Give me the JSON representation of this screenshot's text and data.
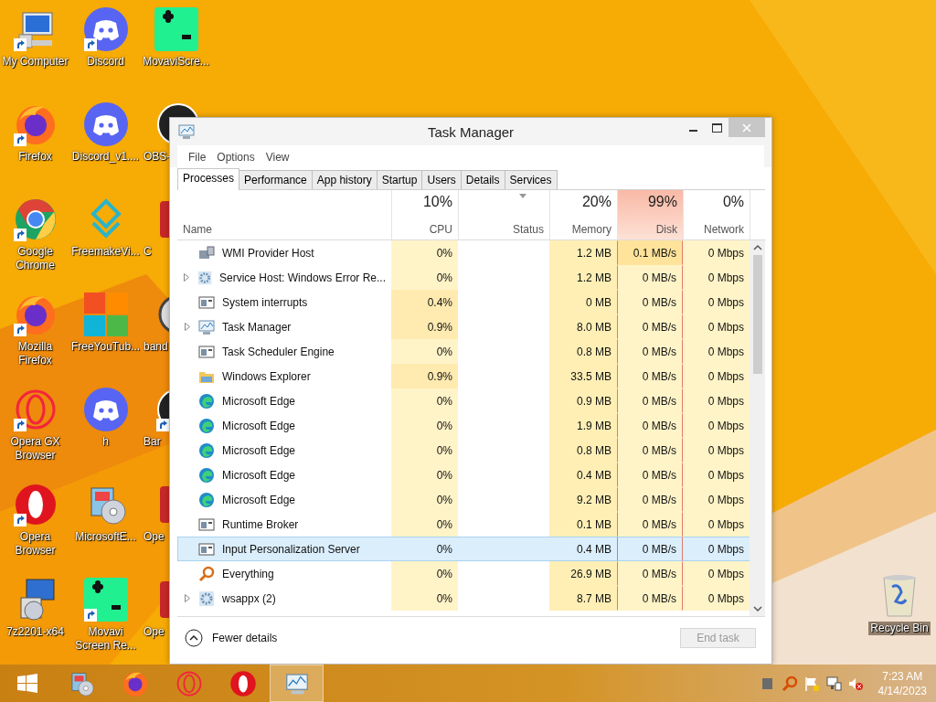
{
  "desktop_icons": [
    {
      "label": "My Computer",
      "kind": "computer",
      "shortcut": true
    },
    {
      "label": "Discord",
      "kind": "discord",
      "shortcut": true
    },
    {
      "label": "MovaviScre...",
      "kind": "movavi",
      "shortcut": false
    },
    {
      "label": "Firefox",
      "kind": "firefox",
      "shortcut": true
    },
    {
      "label": "Discord_v1....",
      "kind": "discord",
      "shortcut": false
    },
    {
      "label": "OBS-",
      "kind": "obs",
      "shortcut": false
    },
    {
      "label": "Google Chrome",
      "kind": "chrome",
      "shortcut": true
    },
    {
      "label": "FreemakeVi...",
      "kind": "freemake",
      "shortcut": false
    },
    {
      "label": "C",
      "kind": "redapp",
      "shortcut": false
    },
    {
      "label": "Mozilla Firefox",
      "kind": "firefox",
      "shortcut": true
    },
    {
      "label": "FreeYouTub...",
      "kind": "tiles",
      "shortcut": false
    },
    {
      "label": "band",
      "kind": "disc",
      "shortcut": false
    },
    {
      "label": "Opera GX Browser",
      "kind": "operagx",
      "shortcut": true
    },
    {
      "label": "h",
      "kind": "discord",
      "shortcut": false
    },
    {
      "label": "Bar",
      "kind": "obs",
      "shortcut": true
    },
    {
      "label": "Opera Browser",
      "kind": "opera",
      "shortcut": true
    },
    {
      "label": "MicrosoftE...",
      "kind": "installer",
      "shortcut": false
    },
    {
      "label": "Ope",
      "kind": "redapp",
      "shortcut": false
    },
    {
      "label": "7z2201-x64",
      "kind": "setup",
      "shortcut": false
    },
    {
      "label": "Movavi Screen Re...",
      "kind": "movavi",
      "shortcut": true
    },
    {
      "label": "Ope",
      "kind": "redapp",
      "shortcut": false
    }
  ],
  "recycle_bin": {
    "label": "Recycle Bin"
  },
  "window": {
    "title": "Task Manager",
    "menu": [
      "File",
      "Options",
      "View"
    ],
    "tabs": [
      {
        "label": "Processes",
        "selected": true
      },
      {
        "label": "Performance",
        "selected": false
      },
      {
        "label": "App history",
        "selected": false
      },
      {
        "label": "Startup",
        "selected": false
      },
      {
        "label": "Users",
        "selected": false
      },
      {
        "label": "Details",
        "selected": false
      },
      {
        "label": "Services",
        "selected": false
      }
    ],
    "columns": [
      {
        "kind": "name",
        "label": "Name"
      },
      {
        "kind": "cpu",
        "percent": "10%",
        "label": "CPU",
        "hot": false
      },
      {
        "kind": "status",
        "label": "Status"
      },
      {
        "kind": "memory",
        "percent": "20%",
        "label": "Memory",
        "hot": false
      },
      {
        "kind": "disk",
        "percent": "99%",
        "label": "Disk",
        "hot": true
      },
      {
        "kind": "network",
        "percent": "0%",
        "label": "Network",
        "hot": false
      }
    ],
    "rows": [
      {
        "name": "WMI Provider Host",
        "kind": "wmi",
        "expandable": false,
        "cpu": "0%",
        "cpu_busy": false,
        "memory": "1.2 MB",
        "disk": "0.1 MB/s",
        "disk_busy": true,
        "network": "0 Mbps",
        "selected": false
      },
      {
        "name": "Service Host: Windows Error Re...",
        "kind": "gear",
        "expandable": true,
        "cpu": "0%",
        "cpu_busy": false,
        "memory": "1.2 MB",
        "disk": "0 MB/s",
        "disk_busy": false,
        "network": "0 Mbps",
        "selected": false
      },
      {
        "name": "System interrupts",
        "kind": "window",
        "expandable": false,
        "cpu": "0.4%",
        "cpu_busy": true,
        "memory": "0 MB",
        "disk": "0 MB/s",
        "disk_busy": false,
        "network": "0 Mbps",
        "selected": false
      },
      {
        "name": "Task Manager",
        "kind": "taskmgr",
        "expandable": true,
        "cpu": "0.9%",
        "cpu_busy": true,
        "memory": "8.0 MB",
        "disk": "0 MB/s",
        "disk_busy": false,
        "network": "0 Mbps",
        "selected": false
      },
      {
        "name": "Task Scheduler Engine",
        "kind": "window",
        "expandable": false,
        "cpu": "0%",
        "cpu_busy": false,
        "memory": "0.8 MB",
        "disk": "0 MB/s",
        "disk_busy": false,
        "network": "0 Mbps",
        "selected": false
      },
      {
        "name": "Windows Explorer",
        "kind": "folder",
        "expandable": false,
        "cpu": "0.9%",
        "cpu_busy": true,
        "memory": "33.5 MB",
        "disk": "0 MB/s",
        "disk_busy": false,
        "network": "0 Mbps",
        "selected": false
      },
      {
        "name": "Microsoft Edge",
        "kind": "edge",
        "expandable": false,
        "cpu": "0%",
        "cpu_busy": false,
        "memory": "0.9 MB",
        "disk": "0 MB/s",
        "disk_busy": false,
        "network": "0 Mbps",
        "selected": false
      },
      {
        "name": "Microsoft Edge",
        "kind": "edge",
        "expandable": false,
        "cpu": "0%",
        "cpu_busy": false,
        "memory": "1.9 MB",
        "disk": "0 MB/s",
        "disk_busy": false,
        "network": "0 Mbps",
        "selected": false
      },
      {
        "name": "Microsoft Edge",
        "kind": "edge",
        "expandable": false,
        "cpu": "0%",
        "cpu_busy": false,
        "memory": "0.8 MB",
        "disk": "0 MB/s",
        "disk_busy": false,
        "network": "0 Mbps",
        "selected": false
      },
      {
        "name": "Microsoft Edge",
        "kind": "edge",
        "expandable": false,
        "cpu": "0%",
        "cpu_busy": false,
        "memory": "0.4 MB",
        "disk": "0 MB/s",
        "disk_busy": false,
        "network": "0 Mbps",
        "selected": false
      },
      {
        "name": "Microsoft Edge",
        "kind": "edge",
        "expandable": false,
        "cpu": "0%",
        "cpu_busy": false,
        "memory": "9.2 MB",
        "disk": "0 MB/s",
        "disk_busy": false,
        "network": "0 Mbps",
        "selected": false
      },
      {
        "name": "Runtime Broker",
        "kind": "window",
        "expandable": false,
        "cpu": "0%",
        "cpu_busy": false,
        "memory": "0.1 MB",
        "disk": "0 MB/s",
        "disk_busy": false,
        "network": "0 Mbps",
        "selected": false
      },
      {
        "name": "Input Personalization Server",
        "kind": "window",
        "expandable": false,
        "cpu": "0%",
        "cpu_busy": false,
        "memory": "0.4 MB",
        "disk": "0 MB/s",
        "disk_busy": false,
        "network": "0 Mbps",
        "selected": true
      },
      {
        "name": "Everything",
        "kind": "search",
        "expandable": false,
        "cpu": "0%",
        "cpu_busy": false,
        "memory": "26.9 MB",
        "disk": "0 MB/s",
        "disk_busy": false,
        "network": "0 Mbps",
        "selected": false
      },
      {
        "name": "wsappx (2)",
        "kind": "gear",
        "expandable": true,
        "cpu": "0%",
        "cpu_busy": false,
        "memory": "8.7 MB",
        "disk": "0 MB/s",
        "disk_busy": false,
        "network": "0 Mbps",
        "selected": false
      }
    ],
    "fewer_details": "Fewer details",
    "end_task": {
      "label": "End task",
      "disabled": true
    }
  },
  "taskbar": {
    "apps": [
      {
        "kind": "installer",
        "selected": false
      },
      {
        "kind": "firefox",
        "selected": false
      },
      {
        "kind": "operagx",
        "selected": false
      },
      {
        "kind": "opera",
        "selected": false
      },
      {
        "kind": "taskmgr",
        "selected": true
      }
    ],
    "tray": [
      {
        "kind": "square"
      },
      {
        "kind": "search"
      },
      {
        "kind": "flag"
      },
      {
        "kind": "network"
      },
      {
        "kind": "volume"
      }
    ],
    "time": "7:23 AM",
    "date": "4/14/2023"
  }
}
